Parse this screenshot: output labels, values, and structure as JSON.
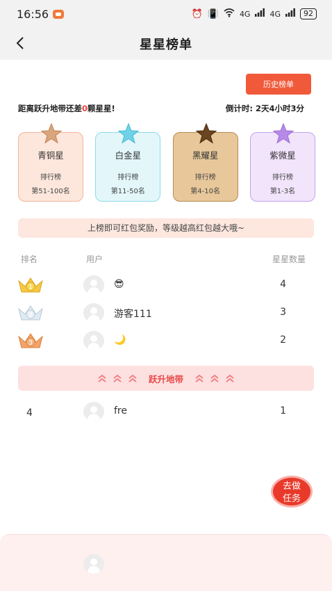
{
  "status_bar": {
    "time": "16:56",
    "network1": "4G",
    "network2": "4G",
    "battery": "92"
  },
  "nav": {
    "title": "星星榜单"
  },
  "history_button": "历史榜单",
  "info": {
    "prefix": "距离跃升地带还差",
    "diff": "0",
    "suffix": "颗星星!",
    "countdown_label": "倒计时:",
    "countdown_value": "2天4小时3分"
  },
  "tiers": [
    {
      "name": "青铜星",
      "label": "排行榜",
      "range": "第51-100名",
      "star_color": "#d9a57c"
    },
    {
      "name": "白金星",
      "label": "排行榜",
      "range": "第11-50名",
      "star_color": "#6fd2e6"
    },
    {
      "name": "黑耀星",
      "label": "排行榜",
      "range": "第4-10名",
      "star_color": "#6b4420"
    },
    {
      "name": "紫微星",
      "label": "排行榜",
      "range": "第1-3名",
      "star_color": "#b78ae8"
    }
  ],
  "notice": "上榜即可红包奖励，等级越高红包越大哦~",
  "table_headers": {
    "rank": "排名",
    "user": "用户",
    "count": "星星数量"
  },
  "ranking": [
    {
      "rank": "1",
      "user": "😎",
      "count": "4",
      "crown": "gold-crown"
    },
    {
      "rank": "2",
      "user": "游客111",
      "count": "3",
      "crown": "silver-crown"
    },
    {
      "rank": "3",
      "user": "🌙",
      "count": "2",
      "crown": "bronze-crown"
    }
  ],
  "promo_band": "跃升地带",
  "ranking_after": [
    {
      "rank": "4",
      "user": "fre",
      "count": "1"
    }
  ],
  "task_button": {
    "line1": "去做",
    "line2": "任务"
  },
  "colors": {
    "accent": "#f05a3a",
    "red_text": "#e84848"
  }
}
